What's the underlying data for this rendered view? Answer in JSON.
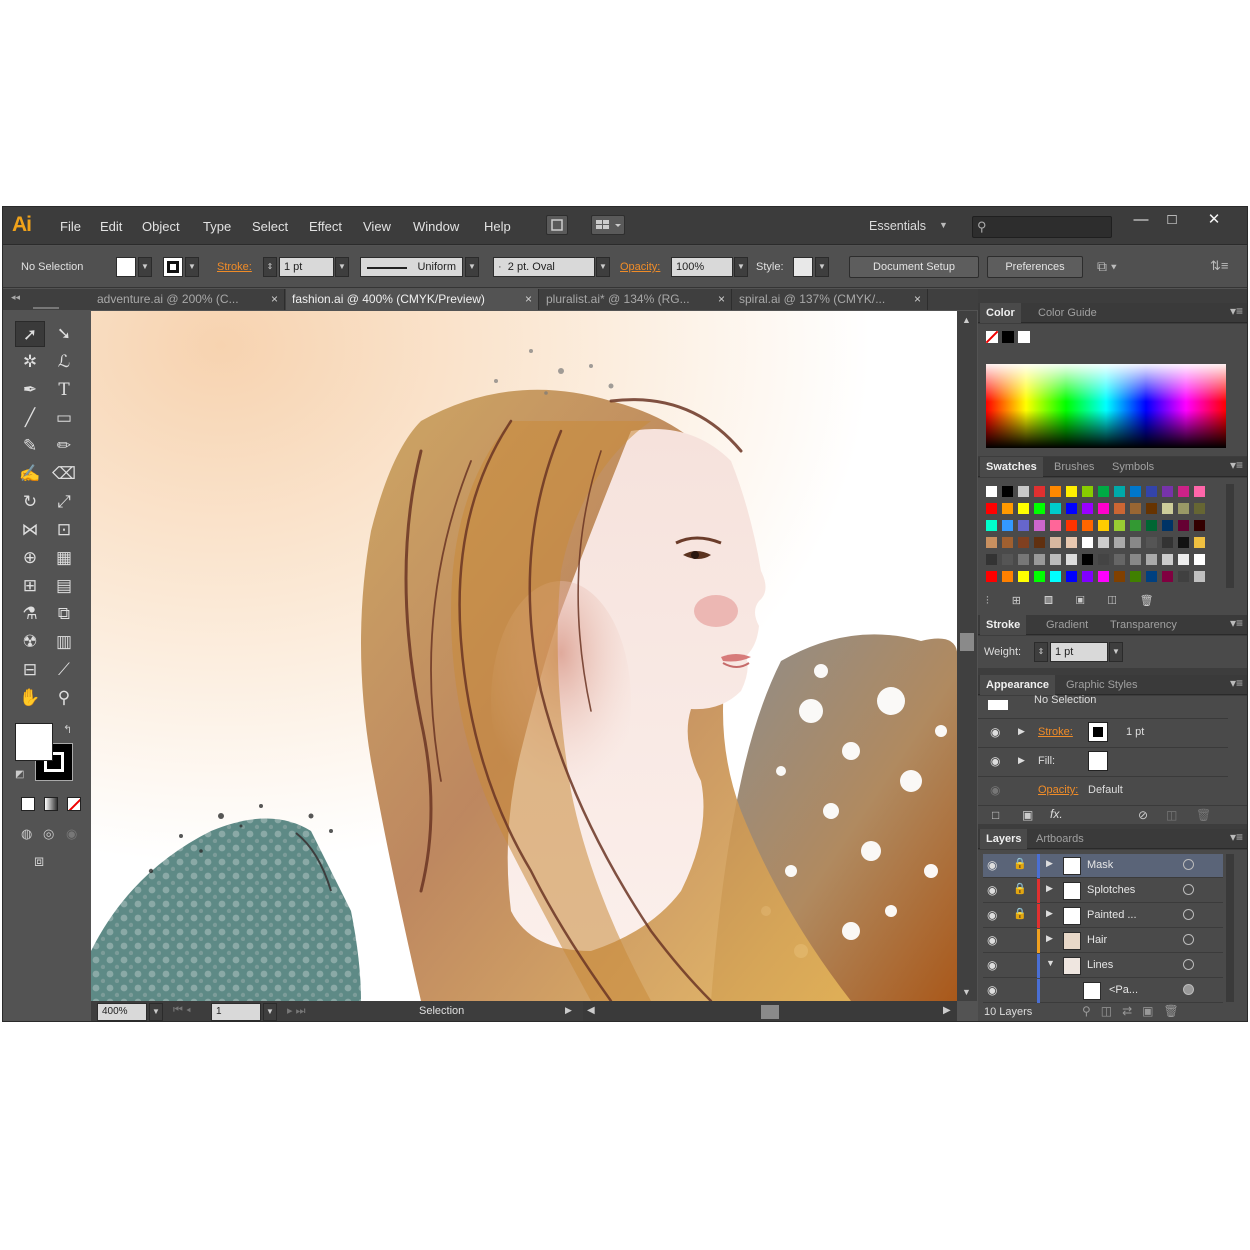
{
  "app": {
    "logo": "Ai"
  },
  "menu": [
    "File",
    "Edit",
    "Object",
    "Type",
    "Select",
    "Effect",
    "View",
    "Window",
    "Help"
  ],
  "workspace": {
    "label": "Essentials"
  },
  "window_controls": {
    "minimize": "—",
    "maximize": "□",
    "close": "✕"
  },
  "control_bar": {
    "selection": "No Selection",
    "stroke_label": "Stroke:",
    "stroke_value": "1 pt",
    "profile": "Uniform",
    "brush": "2 pt. Oval",
    "opacity_label": "Opacity:",
    "opacity_value": "100%",
    "style_label": "Style:",
    "document_setup": "Document Setup",
    "preferences": "Preferences"
  },
  "tabs": [
    {
      "label": "adventure.ai @ 200% (C...",
      "active": false
    },
    {
      "label": "fashion.ai @ 400% (CMYK/Preview)",
      "active": true
    },
    {
      "label": "pluralist.ai* @ 134% (RG...",
      "active": false
    },
    {
      "label": "spiral.ai @ 137% (CMYK/...",
      "active": false
    }
  ],
  "status": {
    "zoom": "400%",
    "page": "1",
    "mode": "Selection"
  },
  "color_panel": {
    "tabs": [
      "Color",
      "Color Guide"
    ]
  },
  "swatches_panel": {
    "tabs": [
      "Swatches",
      "Brushes",
      "Symbols"
    ]
  },
  "stroke_panel": {
    "tabs": [
      "Stroke",
      "Gradient",
      "Transparency"
    ],
    "weight_label": "Weight:",
    "weight_value": "1 pt"
  },
  "appearance_panel": {
    "tabs": [
      "Appearance",
      "Graphic Styles"
    ],
    "heading": "No Selection",
    "stroke_label": "Stroke:",
    "stroke_value": "1 pt",
    "fill_label": "Fill:",
    "opacity_label": "Opacity:",
    "opacity_value": "Default",
    "fx": "fx."
  },
  "layers_panel": {
    "tabs": [
      "Layers",
      "Artboards"
    ],
    "layers": [
      {
        "name": "Mask",
        "color": "#4a6fd4"
      },
      {
        "name": "Splotches",
        "color": "#e03030"
      },
      {
        "name": "Painted ...",
        "color": "#e03030"
      },
      {
        "name": "Hair",
        "color": "#f0a020"
      },
      {
        "name": "Lines",
        "color": "#4a6fd4"
      },
      {
        "name": "<Pa...",
        "color": "#4a6fd4"
      }
    ],
    "count": "10 Layers"
  },
  "swatch_colors": [
    "#ffffff",
    "#000000",
    "#c8c8c8",
    "#e03030",
    "#ff8800",
    "#ffee00",
    "#88cc00",
    "#00aa44",
    "#00aaaa",
    "#0077cc",
    "#3344aa",
    "#7733aa",
    "#cc2288",
    "#ff66aa",
    "#ff0000",
    "#ff9900",
    "#ffff00",
    "#00ff00",
    "#00cccc",
    "#0000ff",
    "#9900ff",
    "#ff00cc",
    "#cc6633",
    "#996633",
    "#663300",
    "#cccc99",
    "#999966",
    "#666633",
    "#00ffcc",
    "#3399ff",
    "#6666cc",
    "#cc66cc",
    "#ff6699",
    "#ff3300",
    "#ff6600",
    "#ffcc00",
    "#99cc33",
    "#339933",
    "#006633",
    "#003366",
    "#660033",
    "#330000",
    "#c89060",
    "#a06030",
    "#804020",
    "#603010",
    "#d8b8a0",
    "#e8c8b0",
    "#ffffff",
    "#cccccc",
    "#aaaaaa",
    "#888888",
    "#555555",
    "#333333",
    "#111111",
    "#f0c040",
    "#333333",
    "#555555",
    "#777777",
    "#999999",
    "#bbbbbb",
    "#dddddd",
    "#000000",
    "#444444",
    "#666666",
    "#888888",
    "#aaaaaa",
    "#cccccc",
    "#eeeeee",
    "#ffffff",
    "#ff0000",
    "#ff8000",
    "#ffff00",
    "#00ff00",
    "#00ffff",
    "#0000ff",
    "#8000ff",
    "#ff00ff",
    "#804000",
    "#408000",
    "#004080",
    "#800040",
    "#404040",
    "#c0c0c0"
  ]
}
